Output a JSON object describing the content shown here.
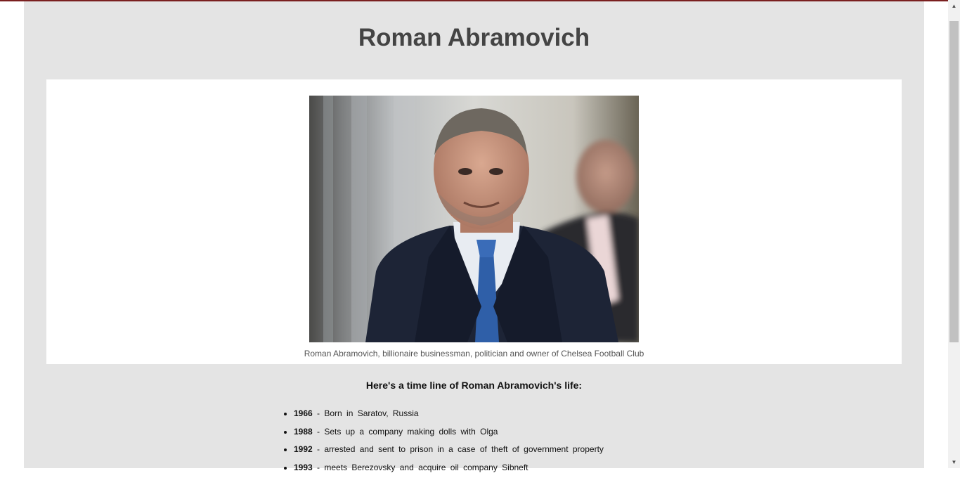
{
  "page": {
    "title": "Roman Abramovich"
  },
  "figure": {
    "caption": "Roman Abramovich, billionaire businessman, politician and owner of Chelsea Football Club"
  },
  "timeline": {
    "heading": "Here's a time line of Roman Abramovich's life:",
    "items": [
      {
        "year": "1966",
        "text": " - Born in Saratov, Russia"
      },
      {
        "year": "1988",
        "text": " - Sets up a company making dolls with Olga"
      },
      {
        "year": "1992",
        "text": " - arrested and sent to prison in a case of theft of government property"
      },
      {
        "year": "1993",
        "text": " - meets Berezovsky and acquire oil company Sibneft"
      }
    ]
  },
  "scrollbar": {
    "up_icon": "triangle-up-icon",
    "down_icon": "triangle-down-icon"
  },
  "colors": {
    "page_background": "#e4e4e4",
    "title": "#444444",
    "top_accent": "#7a1f1f"
  }
}
